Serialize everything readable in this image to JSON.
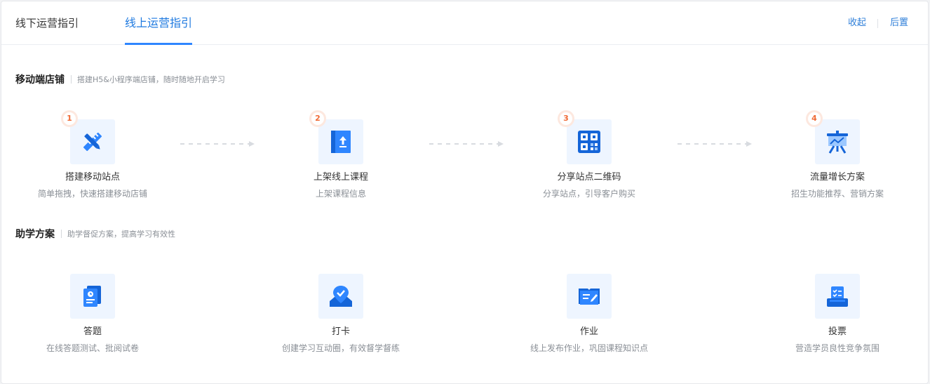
{
  "tabs": [
    {
      "label": "线下运营指引",
      "active": false
    },
    {
      "label": "线上运营指引",
      "active": true
    }
  ],
  "header_actions": {
    "collapse": "收起",
    "move_back": "后置"
  },
  "sections": {
    "store": {
      "title": "移动端店铺",
      "desc": "搭建H5&小程序端店铺，随时随地开启学习",
      "steps": [
        {
          "number": "1",
          "icon": "tools-icon",
          "title": "搭建移动站点",
          "subtitle": "简单拖拽，快速搭建移动店铺"
        },
        {
          "number": "2",
          "icon": "upload-book-icon",
          "title": "上架线上课程",
          "subtitle": "上架课程信息"
        },
        {
          "number": "3",
          "icon": "qrcode-icon",
          "title": "分享站点二维码",
          "subtitle": "分享站点，引导客户购买"
        },
        {
          "number": "4",
          "icon": "growth-board-icon",
          "title": "流量增长方案",
          "subtitle": "招生功能推荐、营销方案"
        }
      ]
    },
    "study": {
      "title": "助学方案",
      "desc": "助学督促方案，提高学习有效性",
      "items": [
        {
          "icon": "quiz-icon",
          "title": "答题",
          "subtitle": "在线答题测试、批阅试卷"
        },
        {
          "icon": "checkin-icon",
          "title": "打卡",
          "subtitle": "创建学习互动圈，有效督学督练"
        },
        {
          "icon": "homework-icon",
          "title": "作业",
          "subtitle": "线上发布作业，巩固课程知识点"
        },
        {
          "icon": "vote-icon",
          "title": "投票",
          "subtitle": "营造学员良性竞争氛围"
        }
      ]
    }
  },
  "colors": {
    "accent": "#2f86ff",
    "badge": "#f06a35",
    "icon_bg": "#eef5ff"
  }
}
